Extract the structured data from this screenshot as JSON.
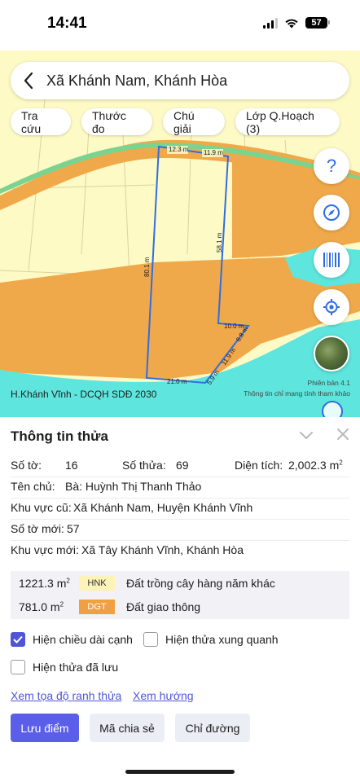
{
  "status_bar": {
    "time": "14:41",
    "battery": "57"
  },
  "search": {
    "title": "Xã Khánh Nam, Khánh Hòa"
  },
  "chips": [
    "Tra cứu",
    "Thước đo",
    "Chú giải",
    "Lớp Q.Hoạch (3)"
  ],
  "map": {
    "edge_labels": {
      "top_left": "12.3 m",
      "top_right": "11.9 m",
      "left": "80.1 m",
      "right_upper": "58.1 m",
      "step": "10.0 m",
      "right_mid": "6.8 m",
      "right_lower": "11.9 m",
      "bottom_right": "5.9 m",
      "bottom": "21.0 m"
    },
    "source_label": "H.Khánh Vĩnh - DCQH SDĐ 2030",
    "version": "Phiên bản 4.1",
    "note": "Thông tin chỉ mang tính tham khảo",
    "colors": {
      "base": "#fdfac6",
      "orange": "#f0a94a",
      "water": "#5ee6de",
      "parcel": "#2f6de1"
    }
  },
  "sheet": {
    "title": "Thông tin thửa",
    "so_to_label": "Số tờ:",
    "so_to_value": "16",
    "so_thua_label": "Số thửa:",
    "so_thua_value": "69",
    "dien_tich_label": "Diện tích:",
    "dien_tich_value": "2,002.3 m",
    "dien_tich_unit_sup": "2",
    "ten_chu_label": "Tên chủ:",
    "ten_chu_value": "Bà: Huỳnh Thị Thanh Thảo",
    "khu_vuc_cu_label": "Khu vực cũ:",
    "khu_vuc_cu_value": "Xã Khánh Nam, Huyện Khánh Vĩnh",
    "so_to_moi_label": "Số tờ mới:",
    "so_to_moi_value": "57",
    "khu_vuc_moi_label": "Khu vực mới:",
    "khu_vuc_moi_value": "Xã Tây Khánh Vĩnh, Khánh Hòa",
    "land_use": [
      {
        "area": "1221.3 m",
        "sup": "2",
        "code": "HNK",
        "name": "Đất trồng cây hàng năm khác",
        "code_bg": "#fdf3b8",
        "code_color": "#333333"
      },
      {
        "area": "781.0 m",
        "sup": "2",
        "code": "DGT",
        "name": "Đất giao thông",
        "code_bg": "#f0a040",
        "code_color": "#ffffff"
      }
    ],
    "checkboxes": [
      {
        "label": "Hiện chiều dài cạnh",
        "checked": true
      },
      {
        "label": "Hiện thửa xung quanh",
        "checked": false
      },
      {
        "label": "Hiện thửa đã lưu",
        "checked": false
      }
    ],
    "links": [
      "Xem tọa độ ranh thửa",
      "Xem hướng"
    ],
    "buttons": [
      "Lưu điểm",
      "Mã chia sẻ",
      "Chỉ đường"
    ]
  }
}
